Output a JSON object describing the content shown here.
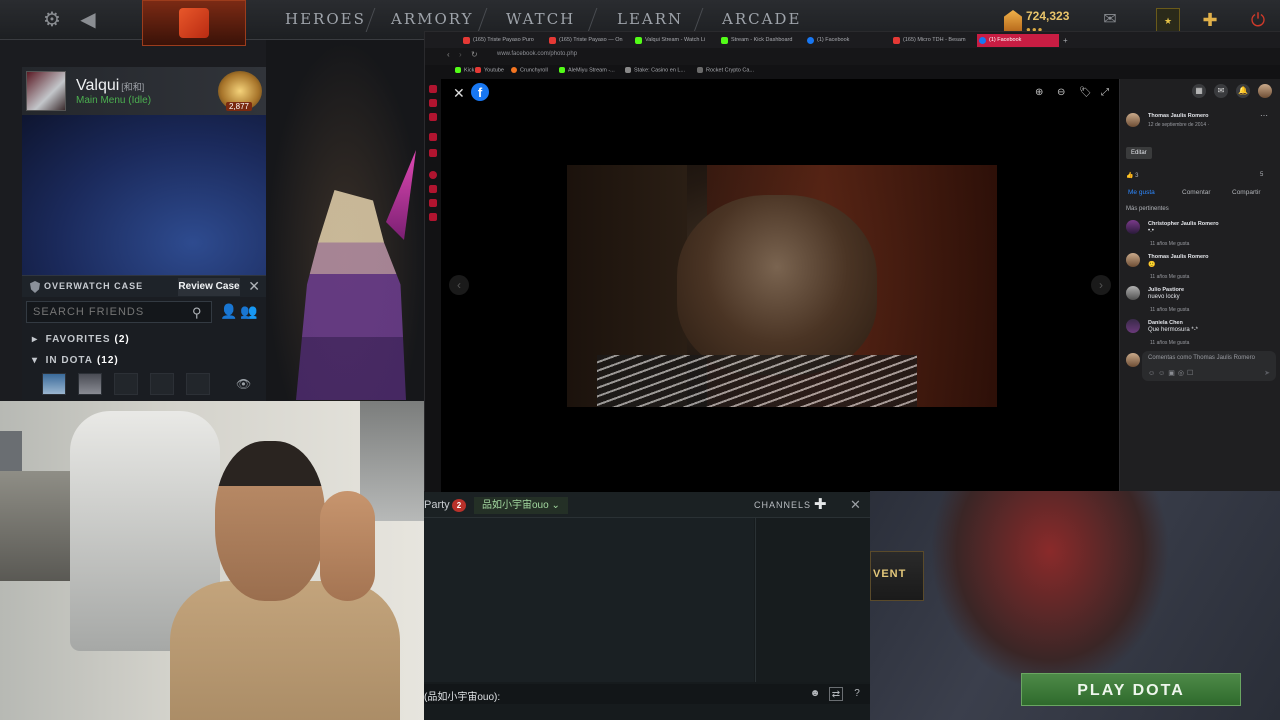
{
  "topbar": {
    "nav": [
      "HEROES",
      "ARMORY",
      "WATCH",
      "LEARN",
      "ARCADE"
    ],
    "currency": "724,323",
    "currency_dots": "●●●"
  },
  "friends": {
    "player_name": "Valqui",
    "player_tag": "[和和]",
    "status": "Main Menu (Idle)",
    "rank": "2,877",
    "overwatch_title": "OVERWATCH CASE",
    "review_label": "Review Case",
    "search_placeholder": "SEARCH FRIENDS",
    "groups": [
      {
        "label": "FAVORITES",
        "count": "(2)"
      },
      {
        "label": "IN DOTA",
        "count": "(12)"
      }
    ]
  },
  "browser": {
    "tabs": [
      {
        "label": "(165) Triste Payaso Puro",
        "color": "#e53935"
      },
      {
        "label": "(165) Triste Payaso — On",
        "color": "#e53935"
      },
      {
        "label": "Valqui Stream - Watch Li",
        "color": "#53fc18"
      },
      {
        "label": "Stream - Kick Dashboard",
        "color": "#53fc18"
      },
      {
        "label": "(1) Facebook",
        "color": "#1877f2"
      },
      {
        "label": "(165) Micro TDH - Besam",
        "color": "#e53935"
      },
      {
        "label": "(1) Facebook",
        "color": "#1877f2"
      }
    ],
    "url": "www.facebook.com/photo.php",
    "bookmarks": [
      {
        "label": "Kick",
        "color": "#53fc18"
      },
      {
        "label": "Youtube",
        "color": "#e53935"
      },
      {
        "label": "Crunchyroll",
        "color": "#f47521"
      },
      {
        "label": "AleMiyu Stream -...",
        "color": "#53fc18"
      },
      {
        "label": "Stake: Casino en L...",
        "color": "#888888"
      },
      {
        "label": "Rocket Crypto Ca...",
        "color": "#6a6a6a"
      }
    ]
  },
  "facebook": {
    "logo": "f",
    "author": "Thomas Jaulis Romero",
    "date": "12 de septiembre de 2014 · ",
    "edit_label": "Editar",
    "reactions": "3",
    "comment_count": "5",
    "actions": [
      "Me gusta",
      "Comentar",
      "Compartir"
    ],
    "filter": "Más pertinentes",
    "comments": [
      {
        "name": "Christopher Jaulis Romero",
        "text": "•.•",
        "meta": "11 años   Me gusta"
      },
      {
        "name": "Thomas Jaulis Romero",
        "text": "🙂",
        "meta": "11 años   Me gusta"
      },
      {
        "name": "Julio Pastiore",
        "text": "nuevo locky",
        "meta": "11 años   Me gusta"
      },
      {
        "name": "Daniela Chen",
        "text": "Que hermosura *-*",
        "meta": "11 años   Me gusta"
      }
    ],
    "comment_placeholder": "Comentas como Thomas Jaulis Romero"
  },
  "chat": {
    "party_label": "Party",
    "party_count": "2",
    "channel": "品如小宇宙ouo",
    "channels_label": "CHANNELS",
    "prompt": "(品如小宇宙ouo):"
  },
  "event": {
    "label": "VENT"
  },
  "play_label": "PLAY DOTA"
}
